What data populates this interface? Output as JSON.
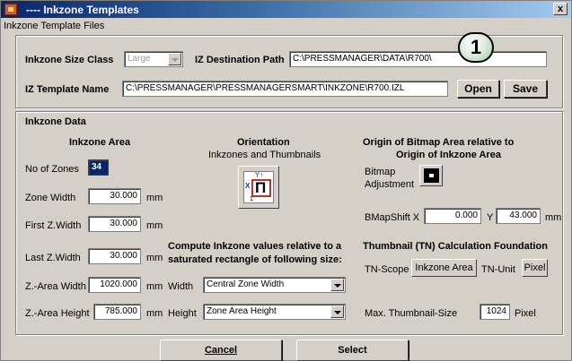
{
  "window": {
    "title": "---- Inkzone Templates",
    "close_glyph": "x",
    "menu_label": "Inkzone Template Files"
  },
  "top": {
    "size_class_label": "Inkzone Size Class",
    "size_class_value": "Large",
    "dest_path_label": "IZ Destination Path",
    "dest_path_value": "C:\\PRESSMANAGER\\DATA\\R700\\",
    "template_name_label": "IZ Template Name",
    "template_name_value": "C:\\PRESSMANAGER\\PRESSMANAGERSMART\\INKZONE\\R700.IZL",
    "open_label": "Open",
    "save_label": "Save",
    "badge": "1"
  },
  "inkzone_data": {
    "section_title": "Inkzone Data",
    "area_title": "Inkzone Area",
    "no_of_zones_label": "No of Zones",
    "no_of_zones_value": "34",
    "zone_width_label": "Zone Width",
    "zone_width_value": "30.000",
    "first_zwidth_label": "First Z.Width",
    "first_zwidth_value": "30.000",
    "last_zwidth_label": "Last Z.Width",
    "last_zwidth_value": "30.000",
    "zarea_width_label": "Z.-Area Width",
    "zarea_width_value": "1020.000",
    "zarea_height_label": "Z.-Area Height",
    "zarea_height_value": "785.000",
    "unit_mm": "mm"
  },
  "orientation": {
    "title": "Orientation",
    "subtitle": "Inkzones and Thumbnails",
    "icon_y": "Y↑",
    "icon_x": "X",
    "icon_one": "1",
    "icon_glyph": "Π"
  },
  "compute": {
    "line1": "Compute Inkzone values relative to a",
    "line2": "saturated rectangle of following size:",
    "width_label": "Width",
    "width_value": "Central Zone Width",
    "height_label": "Height",
    "height_value": "Zone Area Height"
  },
  "origin": {
    "title1": "Origin of Bitmap Area relative to",
    "title2": "Origin of Inkzone Area",
    "bitmap_adj_1": "Bitmap",
    "bitmap_adj_2": "Adjustment",
    "bmapshift_label": "BMapShift X",
    "bmapshift_x": "0.000",
    "y_label": "Y",
    "bmapshift_y": "43.000",
    "unit_mm": "mm"
  },
  "thumbnail": {
    "title": "Thumbnail (TN) Calculation Foundation",
    "tn_scope_label": "TN-Scope",
    "tn_scope_button": "Inkzone Area",
    "tn_unit_label": "TN-Unit",
    "tn_unit_button": "Pixel",
    "max_size_label": "Max. Thumbnail-Size",
    "max_size_value": "1024",
    "max_size_unit": "Pixel"
  },
  "footer": {
    "cancel_label": "Cancel",
    "select_label": "Select"
  }
}
